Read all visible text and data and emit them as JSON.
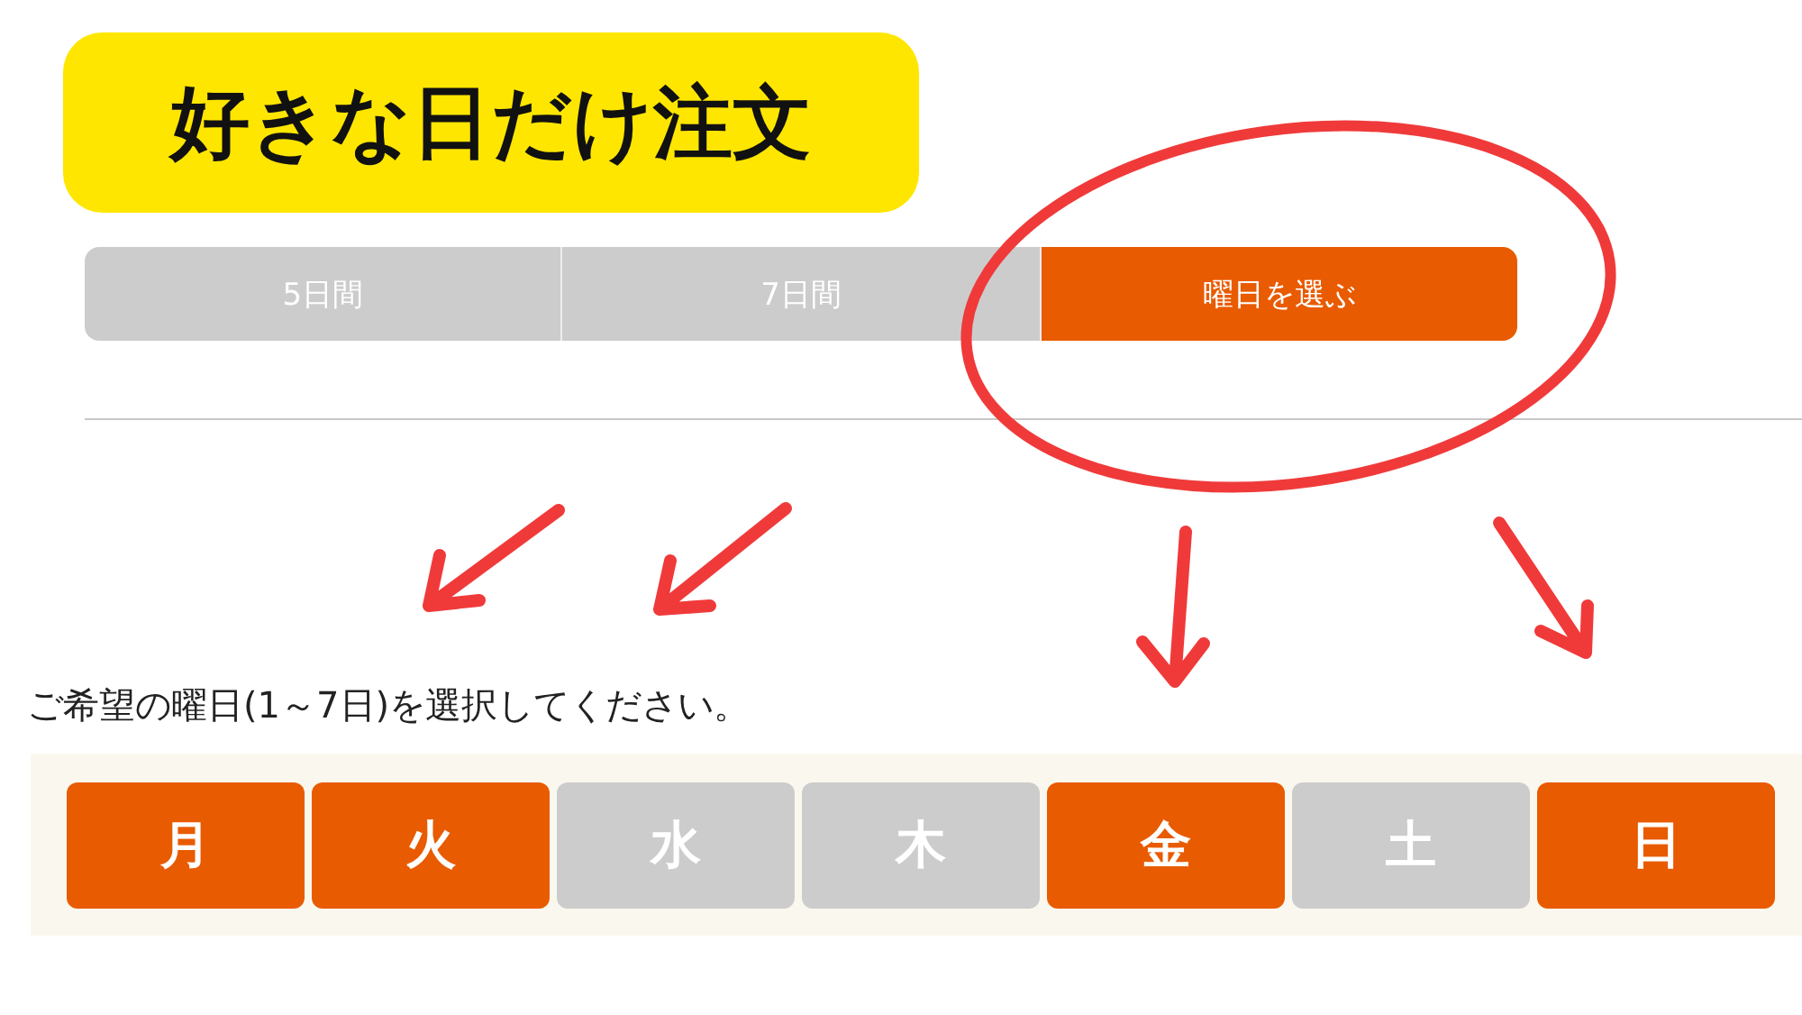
{
  "banner": {
    "title": "好きな日だけ注文"
  },
  "tabs": [
    {
      "label": "5日間",
      "selected": false
    },
    {
      "label": "7日間",
      "selected": false
    },
    {
      "label": "曜日を選ぶ",
      "selected": true
    }
  ],
  "instruction": "ご希望の曜日(1～7日)を選択してください。",
  "days": [
    {
      "label": "月",
      "selected": true
    },
    {
      "label": "火",
      "selected": true
    },
    {
      "label": "水",
      "selected": false
    },
    {
      "label": "木",
      "selected": false
    },
    {
      "label": "金",
      "selected": true
    },
    {
      "label": "土",
      "selected": false
    },
    {
      "label": "日",
      "selected": true
    }
  ]
}
